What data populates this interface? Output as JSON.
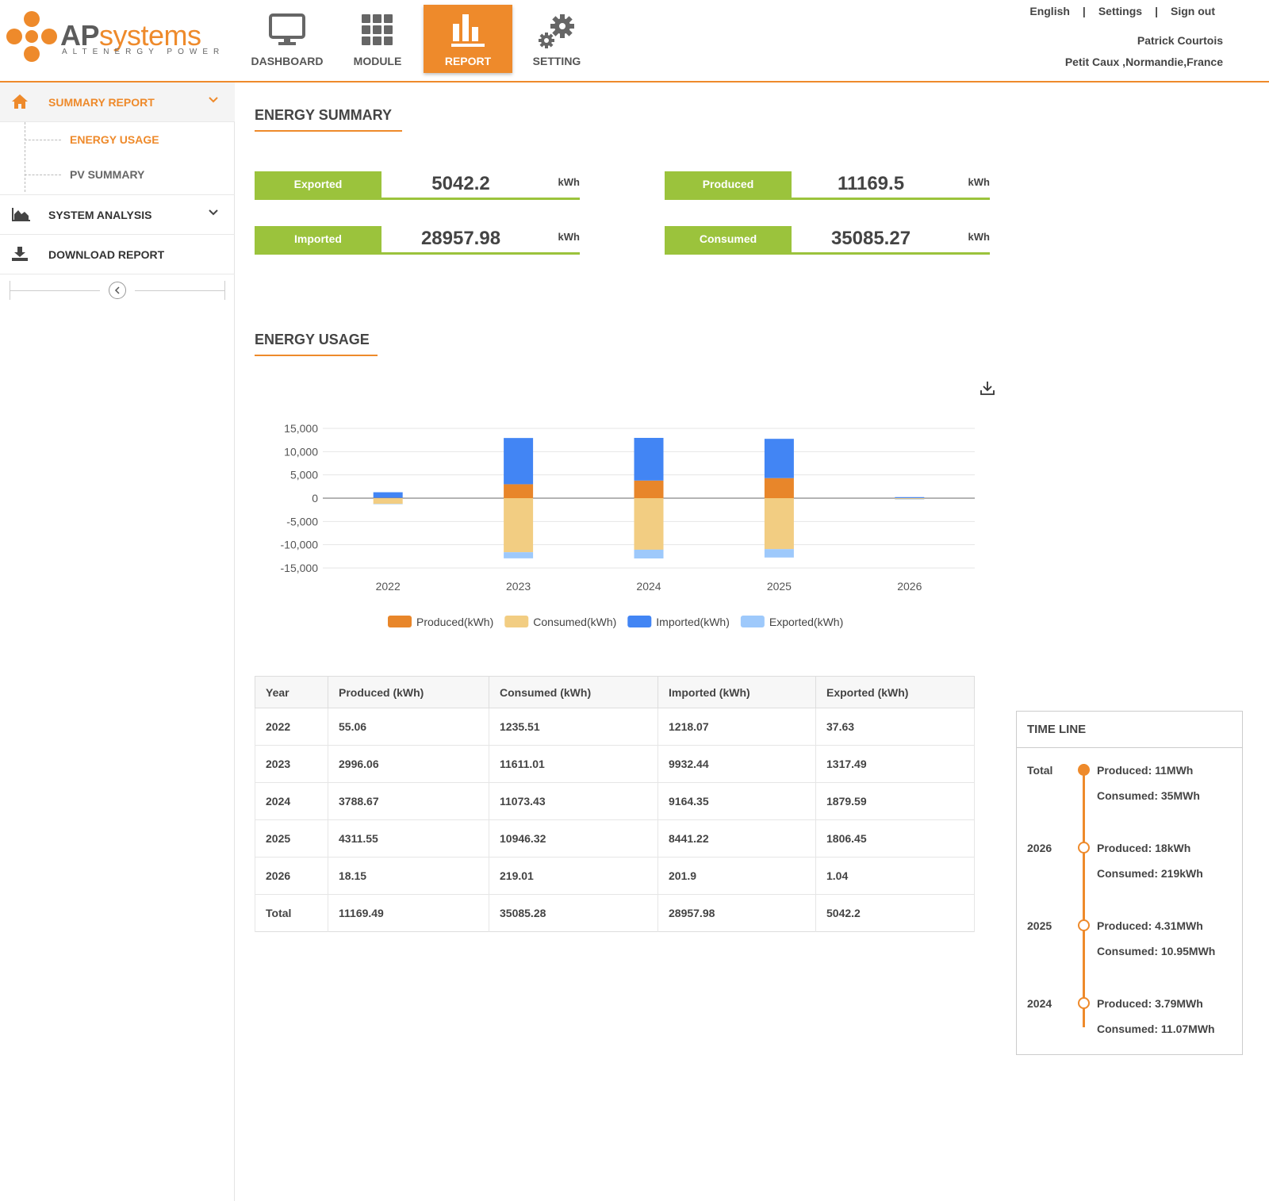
{
  "brand": {
    "name_part1": "AP",
    "name_part2": "systems",
    "tagline": "ALTENERGY POWER",
    "accent": "#ee8a2b",
    "green": "#9bc33c"
  },
  "nav": [
    {
      "label": "DASHBOARD",
      "icon": "monitor-icon"
    },
    {
      "label": "MODULE",
      "icon": "grid-icon"
    },
    {
      "label": "REPORT",
      "icon": "bar-chart-icon",
      "active": true
    },
    {
      "label": "SETTING",
      "icon": "gears-icon"
    }
  ],
  "top_links": {
    "language": "English",
    "settings": "Settings",
    "signout": "Sign out",
    "separator": "|"
  },
  "user": {
    "name": "Patrick Courtois",
    "location": "Petit Caux ,Normandie,France"
  },
  "sidebar": {
    "summary": "SUMMARY REPORT",
    "sub_items": [
      "ENERGY USAGE",
      "PV SUMMARY"
    ],
    "analysis": "SYSTEM ANALYSIS",
    "download": "DOWNLOAD REPORT"
  },
  "energy_summary": {
    "title": "ENERGY SUMMARY",
    "exported": {
      "label": "Exported",
      "value": "5042.2",
      "unit": "kWh"
    },
    "produced": {
      "label": "Produced",
      "value": "11169.5",
      "unit": "kWh"
    },
    "imported": {
      "label": "Imported",
      "value": "28957.98",
      "unit": "kWh"
    },
    "consumed": {
      "label": "Consumed",
      "value": "35085.27",
      "unit": "kWh"
    }
  },
  "energy_usage": {
    "title": "ENERGY USAGE"
  },
  "chart_data": {
    "type": "bar",
    "stacked": true,
    "categories": [
      "2022",
      "2023",
      "2024",
      "2025",
      "2026"
    ],
    "series": [
      {
        "name": "Produced(kWh)",
        "color": "#e8862a",
        "values": [
          55.06,
          2996.06,
          3788.67,
          4311.55,
          18.15
        ]
      },
      {
        "name": "Consumed(kWh)",
        "color": "#f2cd82",
        "values": [
          -1235.51,
          -11611.01,
          -11073.43,
          -10946.32,
          -219.01
        ]
      },
      {
        "name": "Imported(kWh)",
        "color": "#4285f4",
        "values": [
          1218.07,
          9932.44,
          9164.35,
          8441.22,
          201.9
        ]
      },
      {
        "name": "Exported(kWh)",
        "color": "#9ec9fb",
        "values": [
          -37.63,
          -1317.49,
          -1879.59,
          -1806.45,
          -1.04
        ]
      }
    ],
    "yticks": [
      "15,000",
      "10,000",
      "5,000",
      "0",
      "-5,000",
      "-10,000",
      "-15,000"
    ],
    "ylim": [
      -15000,
      15000
    ],
    "grid": true,
    "legend": "bottom"
  },
  "table": {
    "headers": [
      "Year",
      "Produced (kWh)",
      "Consumed (kWh)",
      "Imported (kWh)",
      "Exported (kWh)"
    ],
    "rows": [
      [
        "2022",
        "55.06",
        "1235.51",
        "1218.07",
        "37.63"
      ],
      [
        "2023",
        "2996.06",
        "11611.01",
        "9932.44",
        "1317.49"
      ],
      [
        "2024",
        "3788.67",
        "11073.43",
        "9164.35",
        "1879.59"
      ],
      [
        "2025",
        "4311.55",
        "10946.32",
        "8441.22",
        "1806.45"
      ],
      [
        "2026",
        "18.15",
        "219.01",
        "201.9",
        "1.04"
      ],
      [
        "Total",
        "11169.49",
        "35085.28",
        "28957.98",
        "5042.2"
      ]
    ]
  },
  "timeline": {
    "title": "TIME LINE",
    "entries": [
      {
        "year": "Total",
        "produced": "Produced: 11MWh",
        "consumed": "Consumed: 35MWh"
      },
      {
        "year": "2026",
        "produced": "Produced: 18kWh",
        "consumed": "Consumed: 219kWh"
      },
      {
        "year": "2025",
        "produced": "Produced: 4.31MWh",
        "consumed": "Consumed:  10.95MWh"
      },
      {
        "year": "2024",
        "produced": "Produced: 3.79MWh",
        "consumed": "Consumed:  11.07MWh"
      }
    ]
  }
}
